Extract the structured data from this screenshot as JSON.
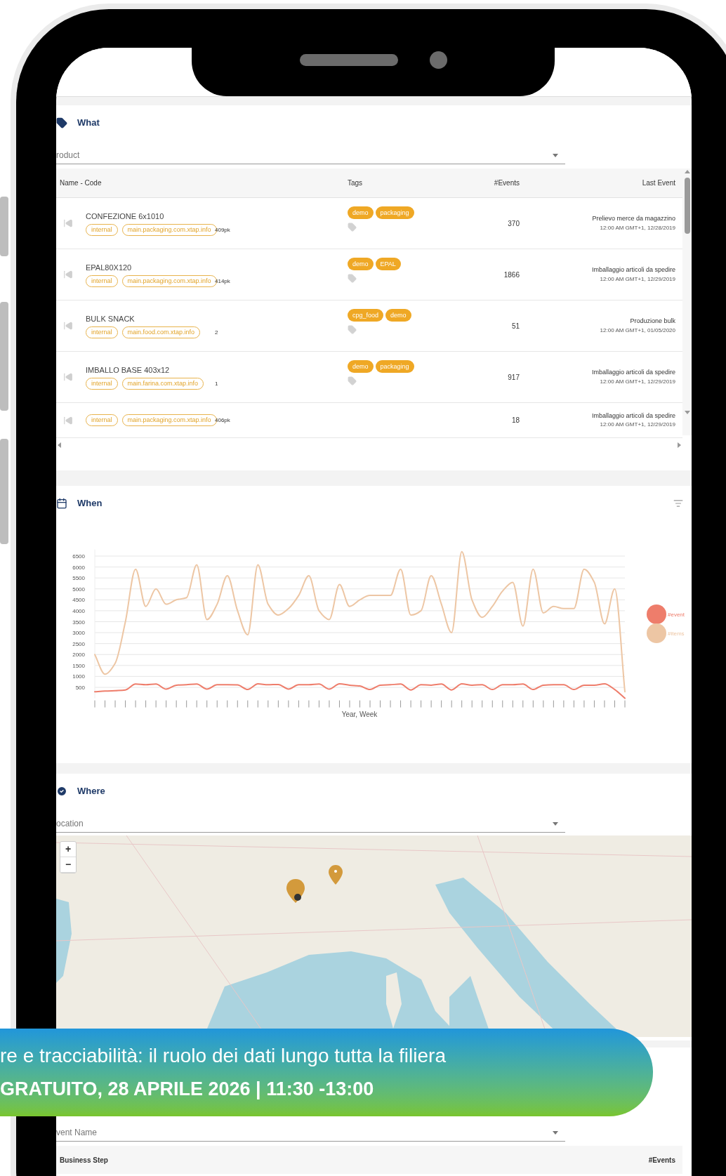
{
  "what": {
    "title": "What",
    "dropdown": {
      "label": "roduct"
    },
    "columns": [
      "Name - Code",
      "Tags",
      "#Events",
      "Last Event"
    ],
    "rows": [
      {
        "name": "CONFEZIONE 6x1010",
        "chips": [
          "internal",
          "main.packaging.com.xtap.info"
        ],
        "quantity": "409pk",
        "tags": [
          "demo",
          "packaging"
        ],
        "events": "370",
        "last_event": "Prelievo merce da magazzino",
        "last_time": "12:00 AM GMT+1, 12/28/2019"
      },
      {
        "name": "EPAL80X120",
        "chips": [
          "internal",
          "main.packaging.com.xtap.info"
        ],
        "quantity": "414pk",
        "tags": [
          "demo",
          "EPAL"
        ],
        "events": "1866",
        "last_event": "Imballaggio articoli da spedire",
        "last_time": "12:00 AM GMT+1, 12/29/2019"
      },
      {
        "name": "BULK SNACK",
        "chips": [
          "internal",
          "main.food.com.xtap.info"
        ],
        "quantity": "2",
        "tags": [
          "cpg_food",
          "demo"
        ],
        "events": "51",
        "last_event": "Produzione bulk",
        "last_time": "12:00 AM GMT+1, 01/05/2020"
      },
      {
        "name": "IMBALLO BASE 403x12",
        "chips": [
          "internal",
          "main.farina.com.xtap.info"
        ],
        "quantity": "1",
        "tags": [
          "demo",
          "packaging"
        ],
        "events": "917",
        "last_event": "Imballaggio articoli da spedire",
        "last_time": "12:00 AM GMT+1, 12/29/2019"
      },
      {
        "chips": [
          "internal",
          "main.packaging.com.xtap.info"
        ],
        "quantity": "406pk",
        "tags": [],
        "events": "18",
        "last_event": "Imballaggio articoli da spedire",
        "last_time": "12:00 AM GMT+1, 12/29/2019"
      }
    ]
  },
  "when": {
    "title": "When",
    "chart_data": {
      "type": "line",
      "xlabel": "Year, Week",
      "grid": true,
      "ylim": [
        0,
        6800
      ],
      "yticks": [
        500,
        1000,
        1500,
        2000,
        2500,
        3000,
        3500,
        4000,
        4500,
        5000,
        5500,
        6000,
        6500
      ],
      "series": [
        {
          "name": "#event",
          "color": "#ee7d6b",
          "values": [
            300,
            330,
            350,
            380,
            650,
            620,
            650,
            420,
            600,
            620,
            650,
            420,
            620,
            620,
            610,
            400,
            660,
            620,
            630,
            420,
            620,
            620,
            650,
            420,
            660,
            600,
            560,
            400,
            600,
            620,
            650,
            380,
            620,
            600,
            650,
            380,
            660,
            600,
            620,
            400,
            620,
            620,
            650,
            400,
            600,
            620,
            620,
            400,
            600,
            600,
            660,
            400,
            0
          ]
        },
        {
          "name": "#items",
          "color": "#edc6a4",
          "values": [
            2000,
            1100,
            1600,
            3500,
            5900,
            4200,
            5000,
            4300,
            4500,
            4600,
            6100,
            3600,
            4300,
            5600,
            4000,
            2900,
            6100,
            4300,
            3800,
            4100,
            4700,
            5600,
            4000,
            3600,
            5200,
            4200,
            4500,
            4700,
            4700,
            4700,
            5900,
            3800,
            4000,
            5600,
            4300,
            3000,
            6700,
            4500,
            3700,
            4200,
            4900,
            5300,
            3300,
            5900,
            3900,
            4200,
            4100,
            4100,
            5900,
            5300,
            3400,
            5000,
            300
          ]
        }
      ]
    }
  },
  "where": {
    "title": "Where",
    "dropdown": {
      "label": "ocation"
    },
    "zoom_buttons": [
      "+",
      "−"
    ]
  },
  "events_panel": {
    "dropdown": {
      "label": "vent Name"
    },
    "columns": [
      "Business Step",
      "#Events"
    ]
  },
  "banner": {
    "line1": "re e tracciabilità: il ruolo dei dati lungo tutta la filiera",
    "line2": "GRATUITO, 28 APRILE 2026 | 11:30 -13:00"
  }
}
